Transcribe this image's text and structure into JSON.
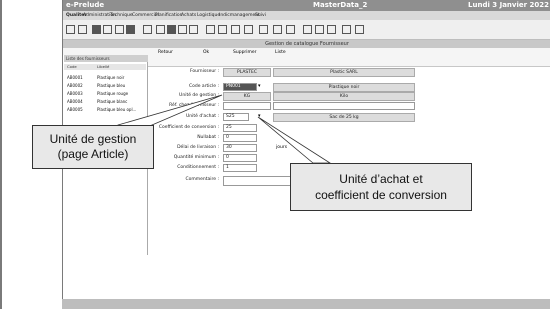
{
  "app": {
    "name": "e-Prelude",
    "window_title": "MasterData_2",
    "date": "Lundi 3 Janvier 2022"
  },
  "menu": [
    "Qualiter",
    "Administration",
    "Technique",
    "Commercial",
    "Planification",
    "Achats",
    "Logistique",
    "Indicmanagement",
    "Suivi"
  ],
  "section_title": "Gestion de catalogue Fournisseur",
  "subtoolbar": {
    "retour": "Retour",
    "ok": "Ok",
    "supprimer": "Supprimer",
    "liste": "Liste"
  },
  "left_panel": {
    "title": "Liste des fournisseurs",
    "head_col1": "Code",
    "head_col2": "Libellé",
    "rows": [
      {
        "code": "AB0001",
        "label": "Plastique noir"
      },
      {
        "code": "AB0002",
        "label": "Plastique bleu"
      },
      {
        "code": "AB0003",
        "label": "Plastique rouge"
      },
      {
        "code": "AB0004",
        "label": "Plastique blanc"
      },
      {
        "code": "AB0005",
        "label": "Plastique bleu opl..."
      }
    ]
  },
  "form": {
    "fournisseur_label": "Fournisseur :",
    "fournisseur_value": "PLASTEC",
    "fournisseur_name": "Plastic SARL",
    "code_article_label": "Code article :",
    "code_article_value": "PN001",
    "code_article_desc": "Plastique noir",
    "unite_gestion_label": "Unité de gestion :",
    "unite_gestion_value": "KG",
    "unite_gestion_desc": "Kilo",
    "ref_fournisseur_label": "Réf. chez fournisseur :",
    "unite_achat_label": "Unité d'achat :",
    "unite_achat_value": "S25",
    "unite_achat_desc": "Sac de 25 kg",
    "coef_label": "Coefficient de conversion :",
    "coef_value": "25",
    "nullable_label": "Nullabat :",
    "nullable_value": "0",
    "delai_label": "Délai de livraison :",
    "delai_value": "30",
    "delai_unit": "jours",
    "qte_min_label": "Quantité minimum :",
    "qte_min_value": "0",
    "conditionnement_label": "Conditionnement :",
    "conditionnement_value": "1",
    "commentaire_label": "Commentaire :"
  },
  "callouts": {
    "left": "Unité de gestion\n(page Article)",
    "right": "Unité d’achat et\ncoefficient de conversion"
  }
}
